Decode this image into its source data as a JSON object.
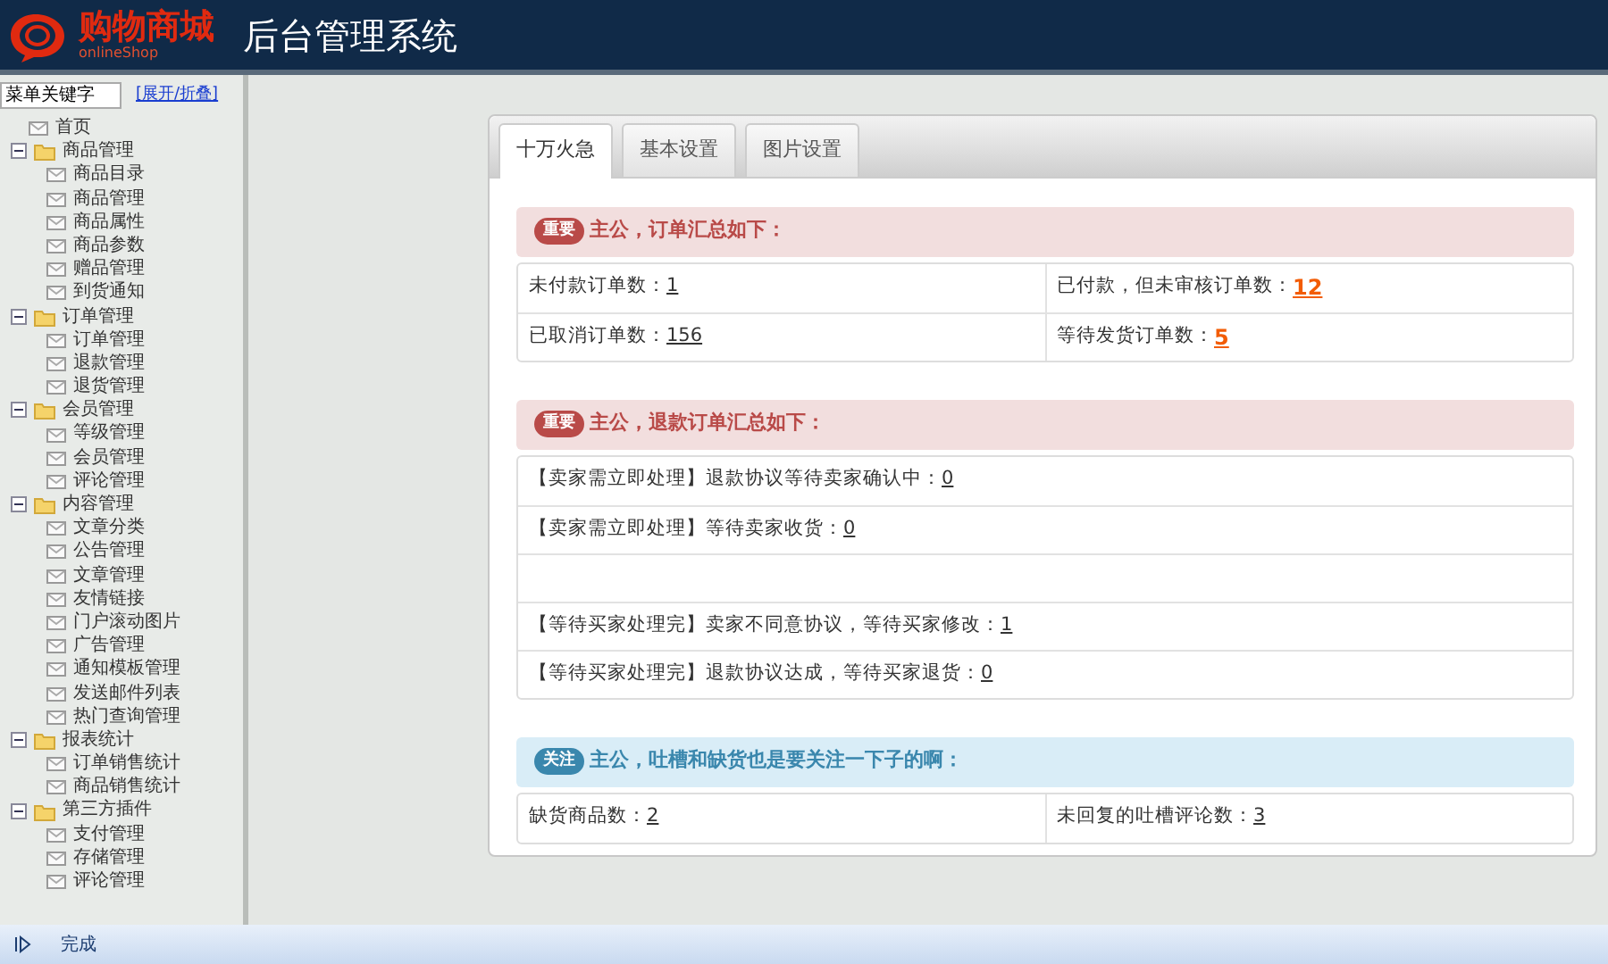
{
  "header": {
    "logo_text": "购物商城",
    "logo_subtext": "onlineShop",
    "title": "后台管理系统"
  },
  "sidebar": {
    "search": {
      "value": "菜单关键字"
    },
    "toggle_link": "[展开/折叠]",
    "tree": [
      {
        "label": "首页"
      },
      {
        "label": "商品管理",
        "expanded": true,
        "children": [
          {
            "label": "商品目录"
          },
          {
            "label": "商品管理"
          },
          {
            "label": "商品属性"
          },
          {
            "label": "商品参数"
          },
          {
            "label": "赠品管理"
          },
          {
            "label": "到货通知"
          }
        ]
      },
      {
        "label": "订单管理",
        "expanded": true,
        "children": [
          {
            "label": "订单管理"
          },
          {
            "label": "退款管理"
          },
          {
            "label": "退货管理"
          }
        ]
      },
      {
        "label": "会员管理",
        "expanded": true,
        "children": [
          {
            "label": "等级管理"
          },
          {
            "label": "会员管理"
          },
          {
            "label": "评论管理"
          }
        ]
      },
      {
        "label": "内容管理",
        "expanded": true,
        "children": [
          {
            "label": "文章分类"
          },
          {
            "label": "公告管理"
          },
          {
            "label": "文章管理"
          },
          {
            "label": "友情链接"
          },
          {
            "label": "门户滚动图片"
          },
          {
            "label": "广告管理"
          },
          {
            "label": "通知模板管理"
          },
          {
            "label": "发送邮件列表"
          },
          {
            "label": "热门查询管理"
          }
        ]
      },
      {
        "label": "报表统计",
        "expanded": true,
        "children": [
          {
            "label": "订单销售统计"
          },
          {
            "label": "商品销售统计"
          }
        ]
      },
      {
        "label": "第三方插件",
        "expanded": true,
        "children": [
          {
            "label": "支付管理"
          },
          {
            "label": "存储管理"
          },
          {
            "label": "评论管理"
          }
        ]
      }
    ]
  },
  "tabs": [
    {
      "label": "十万火急",
      "selected": true
    },
    {
      "label": "基本设置",
      "selected": false
    },
    {
      "label": "图片设置",
      "selected": false
    }
  ],
  "sections": [
    {
      "kind": "important",
      "badge": "重要",
      "title": "主公，订单汇总如下：",
      "rows": [
        {
          "kind": "cells",
          "cells": [
            {
              "label": "未付款订单数：",
              "value": "1",
              "emphasis": false
            },
            {
              "label": "已付款，但未审核订单数：",
              "value": "12",
              "emphasis": true
            }
          ]
        },
        {
          "kind": "cells",
          "cells": [
            {
              "label": "已取消订单数：",
              "value": "156",
              "emphasis": false
            },
            {
              "label": "等待发货订单数：",
              "value": "5",
              "emphasis": true
            }
          ]
        }
      ]
    },
    {
      "kind": "important",
      "badge": "重要",
      "title": "主公，退款订单汇总如下：",
      "rows": [
        {
          "kind": "cells",
          "cells": [
            {
              "label": "【卖家需立即处理】退款协议等待卖家确认中：",
              "value": "0",
              "emphasis": false
            }
          ]
        },
        {
          "kind": "cells",
          "cells": [
            {
              "label": "【卖家需立即处理】等待卖家收货：",
              "value": "0",
              "emphasis": false
            }
          ]
        },
        {
          "kind": "blank"
        },
        {
          "kind": "cells",
          "cells": [
            {
              "label": "【等待买家处理完】卖家不同意协议，等待买家修改：",
              "value": "1",
              "emphasis": false
            }
          ]
        },
        {
          "kind": "cells",
          "cells": [
            {
              "label": "【等待买家处理完】退款协议达成，等待买家退货：",
              "value": "0",
              "emphasis": false
            }
          ]
        }
      ]
    },
    {
      "kind": "notice",
      "badge": "关注",
      "title": "主公，吐槽和缺货也是要关注一下子的啊：",
      "rows": [
        {
          "kind": "cells",
          "cells": [
            {
              "label": "缺货商品数：",
              "value": "2",
              "emphasis": false
            },
            {
              "label": "未回复的吐槽评论数：",
              "value": "3",
              "emphasis": false
            }
          ]
        }
      ]
    }
  ],
  "status_bar": {
    "text": "完成"
  }
}
